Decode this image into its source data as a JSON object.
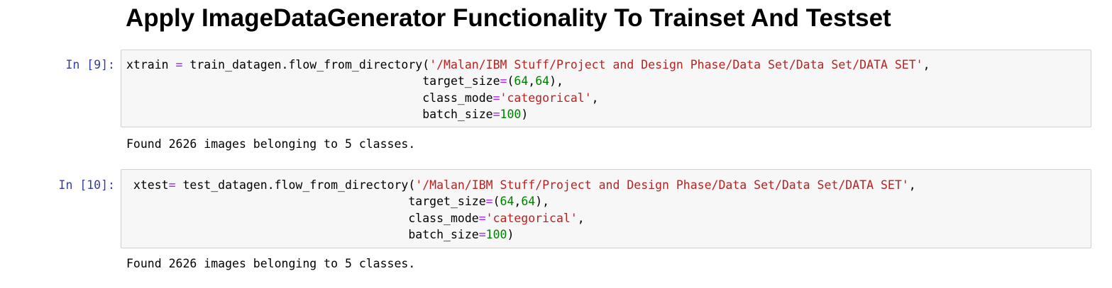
{
  "heading": "Apply ImageDataGenerator Functionality To Trainset And Testset",
  "cells": [
    {
      "prompt": "In [9]:",
      "line1": {
        "var": "xtrain",
        "assign": " = ",
        "call": "train_datagen.flow_from_directory(",
        "path": "'/Malan/IBM Stuff/Project and Design Phase/Data Set/Data Set/DATA SET'",
        "trail": ","
      },
      "indent": "                                          ",
      "target_size": {
        "key": "target_size",
        "eq": "=",
        "open": "(",
        "a": "64",
        "comma": ",",
        "b": "64",
        "close": "),"
      },
      "class_mode": {
        "key": "class_mode",
        "eq": "=",
        "value": "'categorical'",
        "trail": ","
      },
      "batch_size": {
        "key": "batch_size",
        "eq": "=",
        "value": "100",
        "close": ")"
      },
      "output": "Found 2626 images belonging to 5 classes."
    },
    {
      "prompt": "In [10]:",
      "line1": {
        "var": " xtest",
        "assign": "= ",
        "call": "test_datagen.flow_from_directory(",
        "path": "'/Malan/IBM Stuff/Project and Design Phase/Data Set/Data Set/DATA SET'",
        "trail": ","
      },
      "indent": "                                        ",
      "target_size": {
        "key": "target_size",
        "eq": "=",
        "open": "(",
        "a": "64",
        "comma": ",",
        "b": "64",
        "close": "),"
      },
      "class_mode": {
        "key": "class_mode",
        "eq": "=",
        "value": "'categorical'",
        "trail": ","
      },
      "batch_size": {
        "key": "batch_size",
        "eq": "=",
        "value": "100",
        "close": ")"
      },
      "output": "Found 2626 images belonging to 5 classes."
    }
  ],
  "colors": {
    "prompt": "#303F9F",
    "string": "#BA2121",
    "number": "#008000",
    "operator": "#AA22FF",
    "cell_background": "#f7f7f7",
    "cell_border": "#cfcfcf"
  }
}
